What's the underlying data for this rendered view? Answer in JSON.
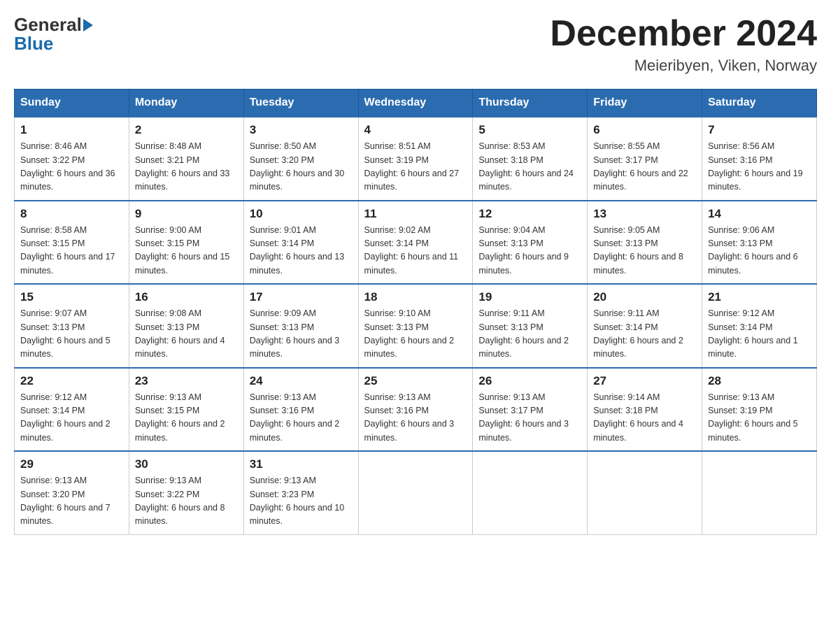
{
  "header": {
    "logo_general": "General",
    "logo_blue": "Blue",
    "month_title": "December 2024",
    "location": "Meieribyen, Viken, Norway"
  },
  "days_of_week": [
    "Sunday",
    "Monday",
    "Tuesday",
    "Wednesday",
    "Thursday",
    "Friday",
    "Saturday"
  ],
  "weeks": [
    [
      {
        "day": "1",
        "sunrise": "8:46 AM",
        "sunset": "3:22 PM",
        "daylight": "6 hours and 36 minutes."
      },
      {
        "day": "2",
        "sunrise": "8:48 AM",
        "sunset": "3:21 PM",
        "daylight": "6 hours and 33 minutes."
      },
      {
        "day": "3",
        "sunrise": "8:50 AM",
        "sunset": "3:20 PM",
        "daylight": "6 hours and 30 minutes."
      },
      {
        "day": "4",
        "sunrise": "8:51 AM",
        "sunset": "3:19 PM",
        "daylight": "6 hours and 27 minutes."
      },
      {
        "day": "5",
        "sunrise": "8:53 AM",
        "sunset": "3:18 PM",
        "daylight": "6 hours and 24 minutes."
      },
      {
        "day": "6",
        "sunrise": "8:55 AM",
        "sunset": "3:17 PM",
        "daylight": "6 hours and 22 minutes."
      },
      {
        "day": "7",
        "sunrise": "8:56 AM",
        "sunset": "3:16 PM",
        "daylight": "6 hours and 19 minutes."
      }
    ],
    [
      {
        "day": "8",
        "sunrise": "8:58 AM",
        "sunset": "3:15 PM",
        "daylight": "6 hours and 17 minutes."
      },
      {
        "day": "9",
        "sunrise": "9:00 AM",
        "sunset": "3:15 PM",
        "daylight": "6 hours and 15 minutes."
      },
      {
        "day": "10",
        "sunrise": "9:01 AM",
        "sunset": "3:14 PM",
        "daylight": "6 hours and 13 minutes."
      },
      {
        "day": "11",
        "sunrise": "9:02 AM",
        "sunset": "3:14 PM",
        "daylight": "6 hours and 11 minutes."
      },
      {
        "day": "12",
        "sunrise": "9:04 AM",
        "sunset": "3:13 PM",
        "daylight": "6 hours and 9 minutes."
      },
      {
        "day": "13",
        "sunrise": "9:05 AM",
        "sunset": "3:13 PM",
        "daylight": "6 hours and 8 minutes."
      },
      {
        "day": "14",
        "sunrise": "9:06 AM",
        "sunset": "3:13 PM",
        "daylight": "6 hours and 6 minutes."
      }
    ],
    [
      {
        "day": "15",
        "sunrise": "9:07 AM",
        "sunset": "3:13 PM",
        "daylight": "6 hours and 5 minutes."
      },
      {
        "day": "16",
        "sunrise": "9:08 AM",
        "sunset": "3:13 PM",
        "daylight": "6 hours and 4 minutes."
      },
      {
        "day": "17",
        "sunrise": "9:09 AM",
        "sunset": "3:13 PM",
        "daylight": "6 hours and 3 minutes."
      },
      {
        "day": "18",
        "sunrise": "9:10 AM",
        "sunset": "3:13 PM",
        "daylight": "6 hours and 2 minutes."
      },
      {
        "day": "19",
        "sunrise": "9:11 AM",
        "sunset": "3:13 PM",
        "daylight": "6 hours and 2 minutes."
      },
      {
        "day": "20",
        "sunrise": "9:11 AM",
        "sunset": "3:14 PM",
        "daylight": "6 hours and 2 minutes."
      },
      {
        "day": "21",
        "sunrise": "9:12 AM",
        "sunset": "3:14 PM",
        "daylight": "6 hours and 1 minute."
      }
    ],
    [
      {
        "day": "22",
        "sunrise": "9:12 AM",
        "sunset": "3:14 PM",
        "daylight": "6 hours and 2 minutes."
      },
      {
        "day": "23",
        "sunrise": "9:13 AM",
        "sunset": "3:15 PM",
        "daylight": "6 hours and 2 minutes."
      },
      {
        "day": "24",
        "sunrise": "9:13 AM",
        "sunset": "3:16 PM",
        "daylight": "6 hours and 2 minutes."
      },
      {
        "day": "25",
        "sunrise": "9:13 AM",
        "sunset": "3:16 PM",
        "daylight": "6 hours and 3 minutes."
      },
      {
        "day": "26",
        "sunrise": "9:13 AM",
        "sunset": "3:17 PM",
        "daylight": "6 hours and 3 minutes."
      },
      {
        "day": "27",
        "sunrise": "9:14 AM",
        "sunset": "3:18 PM",
        "daylight": "6 hours and 4 minutes."
      },
      {
        "day": "28",
        "sunrise": "9:13 AM",
        "sunset": "3:19 PM",
        "daylight": "6 hours and 5 minutes."
      }
    ],
    [
      {
        "day": "29",
        "sunrise": "9:13 AM",
        "sunset": "3:20 PM",
        "daylight": "6 hours and 7 minutes."
      },
      {
        "day": "30",
        "sunrise": "9:13 AM",
        "sunset": "3:22 PM",
        "daylight": "6 hours and 8 minutes."
      },
      {
        "day": "31",
        "sunrise": "9:13 AM",
        "sunset": "3:23 PM",
        "daylight": "6 hours and 10 minutes."
      },
      null,
      null,
      null,
      null
    ]
  ]
}
